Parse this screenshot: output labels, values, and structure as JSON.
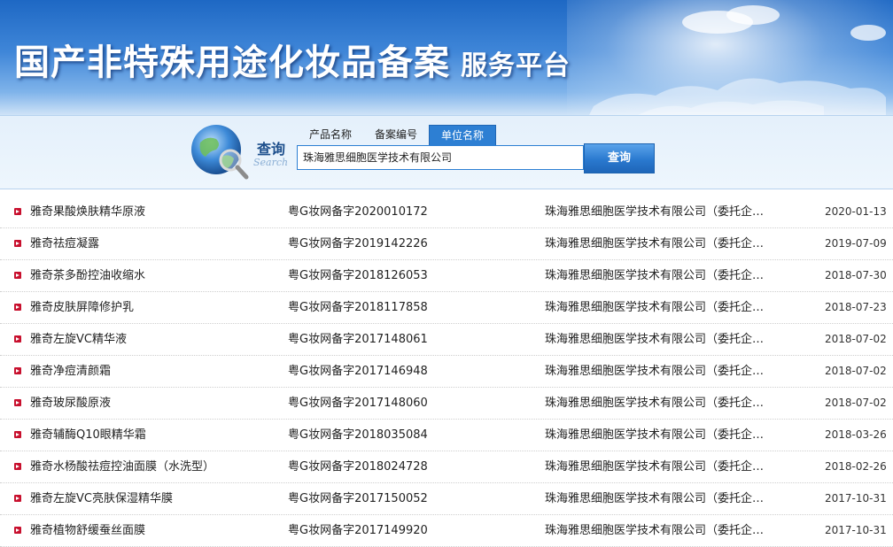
{
  "banner": {
    "title": "国产非特殊用途化妆品备案",
    "subtitle": "服务平台"
  },
  "search": {
    "label_cn": "查询",
    "label_en": "Search",
    "tabs": [
      {
        "label": "产品名称",
        "active": false
      },
      {
        "label": "备案编号",
        "active": false
      },
      {
        "label": "单位名称",
        "active": true
      }
    ],
    "input_value": "珠海雅思细胞医学技术有限公司",
    "button_label": "查询"
  },
  "results": [
    {
      "name": "雅奇果酸焕肤精华原液",
      "reg": "粤G妆网备字2020010172",
      "company": "珠海雅思细胞医学技术有限公司（委托企…",
      "date": "2020-01-13"
    },
    {
      "name": "雅奇祛痘凝露",
      "reg": "粤G妆网备字2019142226",
      "company": "珠海雅思细胞医学技术有限公司（委托企…",
      "date": "2019-07-09"
    },
    {
      "name": "雅奇茶多酚控油收缩水",
      "reg": "粤G妆网备字2018126053",
      "company": "珠海雅思细胞医学技术有限公司（委托企…",
      "date": "2018-07-30"
    },
    {
      "name": "雅奇皮肤屏障修护乳",
      "reg": "粤G妆网备字2018117858",
      "company": "珠海雅思细胞医学技术有限公司（委托企…",
      "date": "2018-07-23"
    },
    {
      "name": "雅奇左旋VC精华液",
      "reg": "粤G妆网备字2017148061",
      "company": "珠海雅思细胞医学技术有限公司（委托企…",
      "date": "2018-07-02"
    },
    {
      "name": "雅奇净痘清颜霜",
      "reg": "粤G妆网备字2017146948",
      "company": "珠海雅思细胞医学技术有限公司（委托企…",
      "date": "2018-07-02"
    },
    {
      "name": "雅奇玻尿酸原液",
      "reg": "粤G妆网备字2017148060",
      "company": "珠海雅思细胞医学技术有限公司（委托企…",
      "date": "2018-07-02"
    },
    {
      "name": "雅奇辅酶Q10眼精华霜",
      "reg": "粤G妆网备字2018035084",
      "company": "珠海雅思细胞医学技术有限公司（委托企…",
      "date": "2018-03-26"
    },
    {
      "name": "雅奇水杨酸祛痘控油面膜（水洗型）",
      "reg": "粤G妆网备字2018024728",
      "company": "珠海雅思细胞医学技术有限公司（委托企…",
      "date": "2018-02-26"
    },
    {
      "name": "雅奇左旋VC亮肤保湿精华膜",
      "reg": "粤G妆网备字2017150052",
      "company": "珠海雅思细胞医学技术有限公司（委托企…",
      "date": "2017-10-31"
    },
    {
      "name": "雅奇植物舒缓蚕丝面膜",
      "reg": "粤G妆网备字2017149920",
      "company": "珠海雅思细胞医学技术有限公司（委托企…",
      "date": "2017-10-31"
    }
  ]
}
